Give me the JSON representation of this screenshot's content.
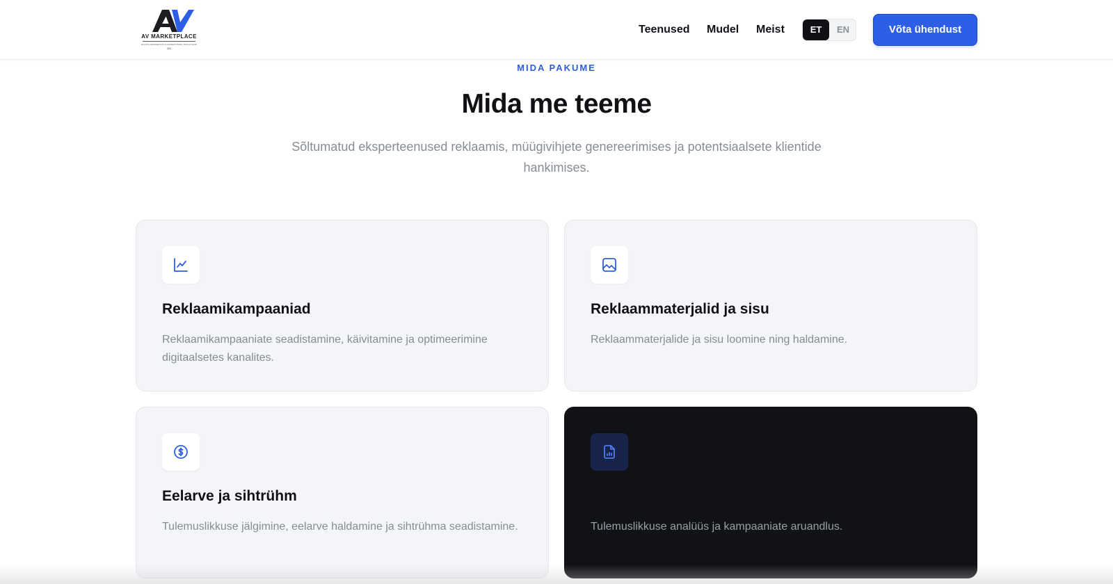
{
  "header": {
    "logo": {
      "name": "AV MARKETPLACE",
      "tagline": "DIGITAL MARKETING & ADVERTISING SOLUTIONS",
      "suffix": "OÜ"
    },
    "nav": [
      {
        "label": "Teenused"
      },
      {
        "label": "Mudel"
      },
      {
        "label": "Meist"
      }
    ],
    "languages": [
      {
        "code": "ET",
        "active": true
      },
      {
        "code": "EN",
        "active": false
      }
    ],
    "cta_label": "Võta ühendust"
  },
  "section": {
    "eyebrow": "MIDA PAKUME",
    "title": "Mida me teeme",
    "subtitle": "Sõltumatud eksperteenused reklaamis, müügivihjete genereerimises ja potentsiaalsete klientide hankimises."
  },
  "cards": [
    {
      "icon": "line-chart-icon",
      "title": "Reklaamikampaaniad",
      "description": "Reklaamikampaaniate seadistamine, käivitamine ja optimeerimine digitaalsetes kanalites."
    },
    {
      "icon": "image-icon",
      "title": "Reklaammaterjalid ja sisu",
      "description": "Reklaammaterjalide ja sisu loomine ning haldamine."
    },
    {
      "icon": "dollar-circle-icon",
      "title": "Eelarve ja sihtrühm",
      "description": "Tulemuslikkuse jälgimine, eelarve haldamine ja sihtrühma seadistamine."
    },
    {
      "icon": "report-file-icon",
      "title": "",
      "description": "Tulemuslikkuse analüüs ja kampaaniate aruandlus."
    }
  ],
  "colors": {
    "accent": "#2d5fe6",
    "eyebrow": "#2f5ed8",
    "text_dark": "#0f1115",
    "text_muted": "#868b94",
    "card_bg": "#f4f5f8",
    "card_dark_bg": "#111215"
  }
}
